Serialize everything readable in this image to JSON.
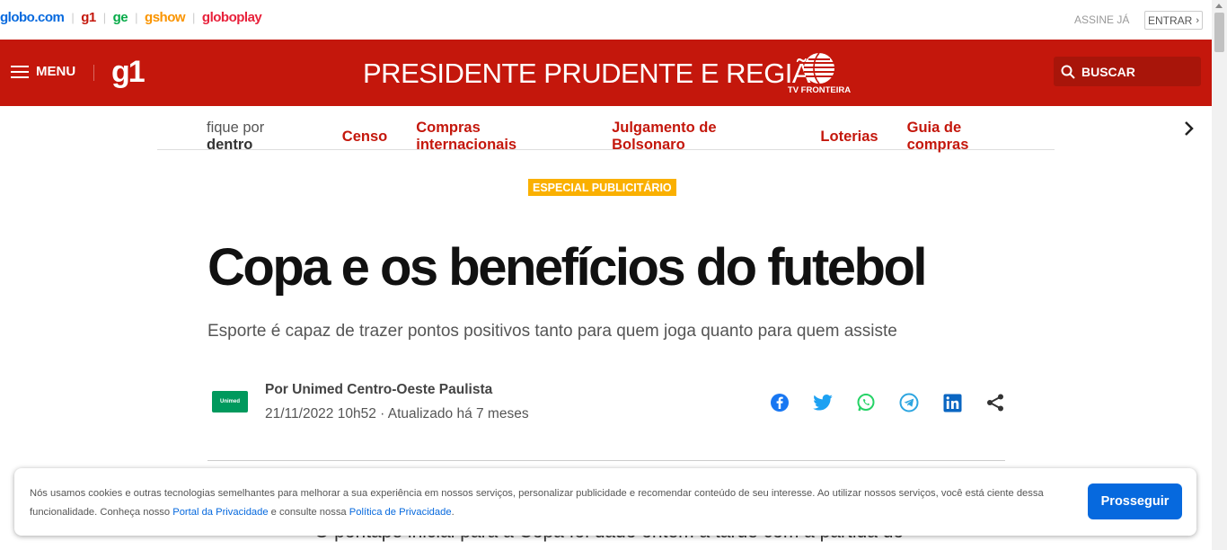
{
  "globobar": {
    "links": [
      "globo.com",
      "g1",
      "ge",
      "gshow",
      "globoplay"
    ],
    "assine": "ASSINE JÁ",
    "entrar": "ENTRAR"
  },
  "header": {
    "menu_label": "MENU",
    "logo": "g1",
    "region": "PRESIDENTE PRUDENTE E REGIÃO",
    "affiliate": "TV FRONTEIRA",
    "search_label": "BUSCAR",
    "color": "#c4170c"
  },
  "nav": {
    "fique_prefix": "fique por",
    "fique_bold": "dentro",
    "items": [
      "Censo",
      "Compras internacionais",
      "Julgamento de Bolsonaro",
      "Loterias",
      "Guia de compras"
    ]
  },
  "article": {
    "badge": "ESPECIAL PUBLICITÁRIO",
    "title": "Copa e os benefícios do futebol",
    "subtitle": "Esporte é capaz de trazer pontos positivos tanto para quem joga quanto para quem assiste",
    "author": "Por Unimed Centro-Oeste Paulista",
    "date": "21/11/2022 10h52 · Atualizado há 7 meses",
    "author_logo_text": "Unimed",
    "body_peek": "O pontapé inicial para a Copa foi dado ontem à tarde com a partida do"
  },
  "share_icons": [
    "facebook-icon",
    "twitter-icon",
    "whatsapp-icon",
    "telegram-icon",
    "linkedin-icon",
    "share-icon"
  ],
  "cookie": {
    "text_before": "Nós usamos cookies e outras tecnologias semelhantes para melhorar a sua experiência em nossos serviços, personalizar publicidade e recomendar conteúdo de seu interesse. Ao utilizar nossos serviços, você está ciente dessa funcionalidade. Conheça nosso ",
    "link1": "Portal da Privacidade",
    "text_middle": " e consulte nossa ",
    "link2": "Política de Privacidade",
    "text_after": ".",
    "button": "Prosseguir"
  }
}
